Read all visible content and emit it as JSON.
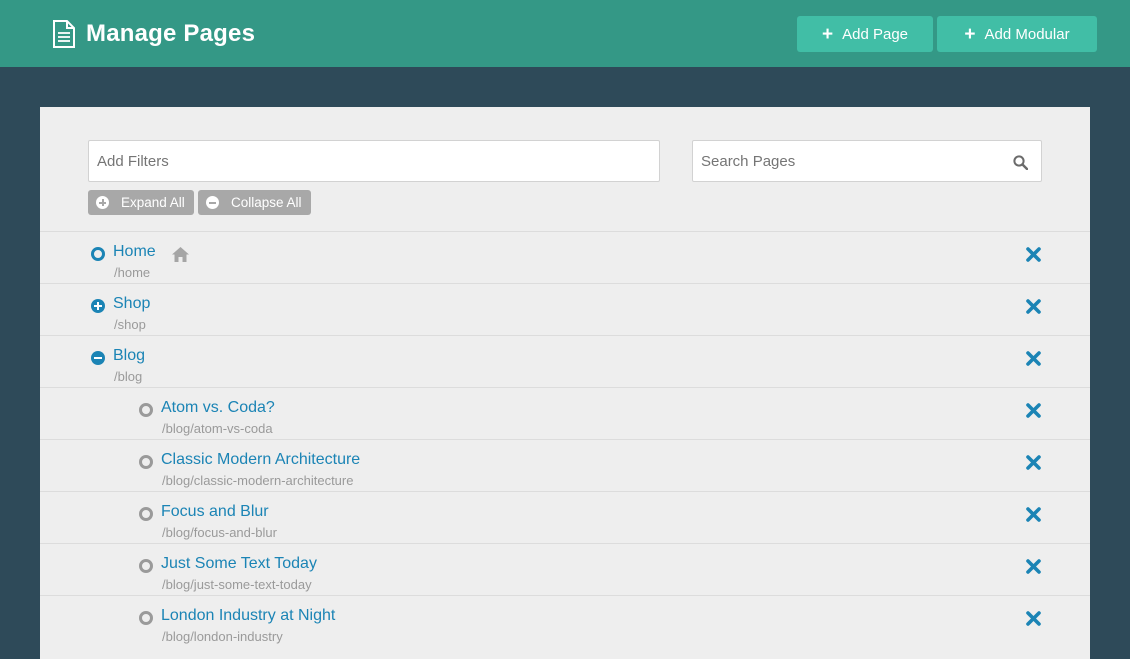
{
  "header": {
    "title": "Manage Pages",
    "title_icon": "document-icon",
    "add_page_label": "Add Page",
    "add_modular_label": "Add Modular",
    "color": "#349886",
    "button_color": "#41bea6"
  },
  "toolbar": {
    "filters_placeholder": "Add Filters",
    "search_placeholder": "Search Pages",
    "expand_all_label": "Expand All",
    "collapse_all_label": "Collapse All"
  },
  "pages": [
    {
      "title": "Home",
      "path": "/home",
      "level": 0,
      "state": "leaf",
      "is_home": true
    },
    {
      "title": "Shop",
      "path": "/shop",
      "level": 0,
      "state": "collapsed"
    },
    {
      "title": "Blog",
      "path": "/blog",
      "level": 0,
      "state": "expanded"
    },
    {
      "title": "Atom vs. Coda?",
      "path": "/blog/atom-vs-coda",
      "level": 1,
      "state": "leaf"
    },
    {
      "title": "Classic Modern Architecture",
      "path": "/blog/classic-modern-architecture",
      "level": 1,
      "state": "leaf"
    },
    {
      "title": "Focus and Blur",
      "path": "/blog/focus-and-blur",
      "level": 1,
      "state": "leaf"
    },
    {
      "title": "Just Some Text Today",
      "path": "/blog/just-some-text-today",
      "level": 1,
      "state": "leaf"
    },
    {
      "title": "London Industry at Night",
      "path": "/blog/london-industry",
      "level": 1,
      "state": "leaf"
    }
  ],
  "colors": {
    "link": "#1b84b5",
    "path": "#9a9a9a",
    "background": "#2e4a59",
    "panel": "#eeeeee"
  }
}
